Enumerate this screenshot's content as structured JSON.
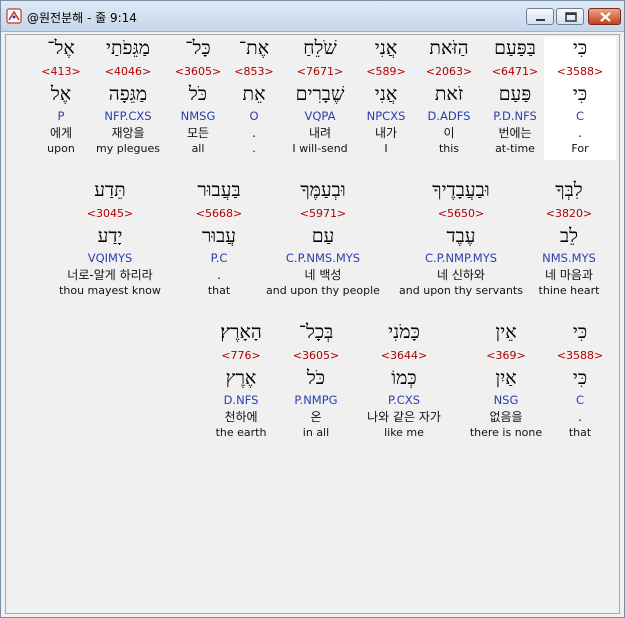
{
  "window": {
    "title": "@원전분해 - 줄 9:14",
    "minimize_label": "minimize",
    "maximize_label": "maximize",
    "close_label": "close"
  },
  "colors": {
    "strong": "#b00000",
    "morph": "#2a3fae",
    "highlight": "#ffffff"
  },
  "rows": [
    {
      "words": [
        {
          "heb": "כִּי",
          "strong": "<3588>",
          "lex": "כִּי",
          "morph": "C",
          "kor": ".",
          "eng": "For",
          "highlight": true
        },
        {
          "heb": "בַּפַּעַם",
          "strong": "<6471>",
          "lex": "פַּעַם",
          "morph": "P.D.NFS",
          "kor": "번에는",
          "eng": "at-time"
        },
        {
          "heb": "הַזֹּאת",
          "strong": "<2063>",
          "lex": "זֹאת",
          "morph": "D.ADFS",
          "kor": "이",
          "eng": "this"
        },
        {
          "heb": "אֲנִי",
          "strong": "<589>",
          "lex": "אֲנִי",
          "morph": "NPCXS",
          "kor": "내가",
          "eng": "I"
        },
        {
          "heb": "שֹׁלֵחַ",
          "strong": "<7671>",
          "lex": "שֶׁבָרִים",
          "morph": "VQPA",
          "kor": "내려",
          "eng": "I will-send"
        },
        {
          "heb": "אֶת־",
          "strong": "<853>",
          "lex": "אֵת",
          "morph": "O",
          "kor": ".",
          "eng": "."
        },
        {
          "heb": "כָּל־",
          "strong": "<3605>",
          "lex": "כֹּל",
          "morph": "NMSG",
          "kor": "모든",
          "eng": "all"
        },
        {
          "heb": "מַגֵּפֹתַי",
          "strong": "<4046>",
          "lex": "מַגֵּפָה",
          "morph": "NFP.CXS",
          "kor": "재앙을",
          "eng": "my plegues"
        },
        {
          "heb": "אֶל־",
          "strong": "<413>",
          "lex": "אֶל",
          "morph": "P",
          "kor": "에게",
          "eng": "upon"
        }
      ]
    },
    {
      "words": [
        {
          "heb": "לִבְּךָ",
          "strong": "<3820>",
          "lex": "לֵב",
          "morph": "NMS.MYS",
          "kor": "네 마음과",
          "eng": "thine heart"
        },
        {
          "heb": "וּבַעֲבָדֶיךָ",
          "strong": "<5650>",
          "lex": "עֶבֶד",
          "morph": "C.P.NMP.MYS",
          "kor": "네 신하와",
          "eng": "and upon thy servants"
        },
        {
          "heb": "וּבְעַמֶּךָ",
          "strong": "<5971>",
          "lex": "עַם",
          "morph": "C.P.NMS.MYS",
          "kor": "네 백성",
          "eng": "and upon thy people"
        },
        {
          "heb": "בַּעֲבוּר",
          "strong": "<5668>",
          "lex": "עֲבוּר",
          "morph": "P.C",
          "kor": ".",
          "eng": "that"
        },
        {
          "heb": "תֵּדַע",
          "strong": "<3045>",
          "lex": "יָדַע",
          "morph": "VQIMYS",
          "kor": "너로-알게 하리라",
          "eng": "thou mayest know"
        }
      ]
    },
    {
      "words": [
        {
          "heb": "כִּי",
          "strong": "<3588>",
          "lex": "כִּי",
          "morph": "C",
          "kor": ".",
          "eng": "that"
        },
        {
          "heb": "אֵין",
          "strong": "<369>",
          "lex": "אַיִן",
          "morph": "NSG",
          "kor": "없음을",
          "eng": "there is none"
        },
        {
          "heb": "כָּמֹנִי",
          "strong": "<3644>",
          "lex": "כְּמוֹ",
          "morph": "P.CXS",
          "kor": "나와 같은 자가",
          "eng": "like me"
        },
        {
          "heb": "בְּכָל־",
          "strong": "<3605>",
          "lex": "כֹּל",
          "morph": "P.NMPG",
          "kor": "온",
          "eng": "in all"
        },
        {
          "heb": "הָאָרֶץ׃",
          "strong": "<776>",
          "lex": "אֶרֶץ",
          "morph": "D.NFS",
          "kor": "천하에",
          "eng": "the earth"
        }
      ]
    }
  ]
}
